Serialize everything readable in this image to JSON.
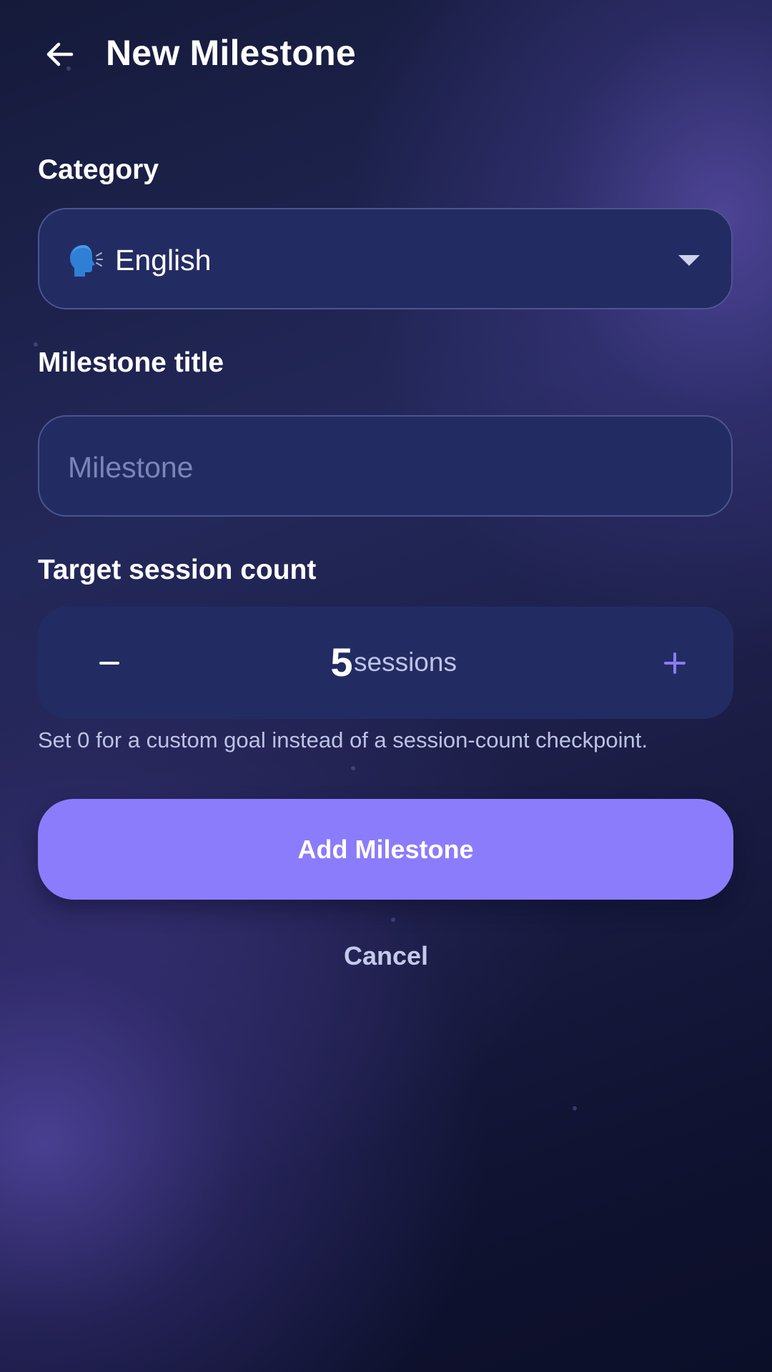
{
  "header": {
    "title": "New Milestone",
    "back_icon": "arrow-left-icon"
  },
  "category": {
    "label": "Category",
    "selected_icon": "speaking-head-icon",
    "selected_value": "English",
    "dropdown_icon": "caret-down-icon"
  },
  "milestone_title": {
    "label": "Milestone title",
    "placeholder": "Milestone",
    "value": ""
  },
  "target_sessions": {
    "label": "Target session count",
    "value": "5",
    "unit": "sessions",
    "decrement_icon": "minus-icon",
    "increment_icon": "plus-icon",
    "helper": "Set 0 for a custom goal instead of a session-count checkpoint."
  },
  "actions": {
    "primary_label": "Add Milestone",
    "cancel_label": "Cancel"
  },
  "colors": {
    "accent": "#8b7cfb",
    "field_background": "#232c62",
    "background_dark": "#0f1230"
  }
}
